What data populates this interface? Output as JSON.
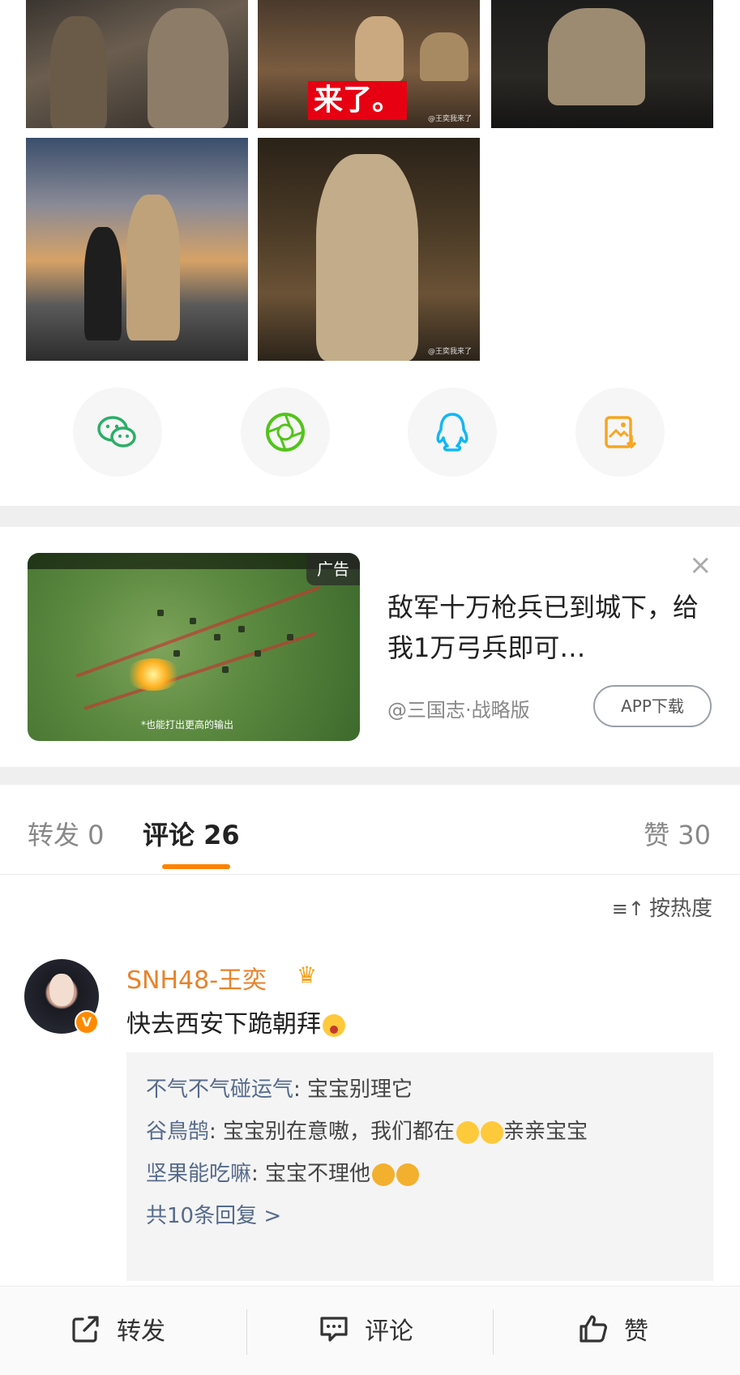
{
  "photos": {
    "grid_overlay_text": "来了。",
    "watermark_2": "@王奕我来了",
    "watermark_5": "@王奕我来了"
  },
  "share": {
    "items": [
      {
        "name": "wechat",
        "color": "#2aae67"
      },
      {
        "name": "moments",
        "color": "#52c41a"
      },
      {
        "name": "qq",
        "color": "#12b7f5"
      },
      {
        "name": "save-image",
        "color": "#f5a623"
      }
    ]
  },
  "ad": {
    "badge": "广告",
    "title": "敌军十万枪兵已到城下，给我1万弓兵即可…",
    "source": "@三国志·战略版",
    "button": "APP下载",
    "caption": "*也能打出更高的输出",
    "close": "×"
  },
  "tabs": {
    "repost": "转发 0",
    "comment": "评论 26",
    "like": "赞 30"
  },
  "sort": {
    "icon": "≡↑",
    "label": "按热度"
  },
  "comment": {
    "author": "SNH48-王奕",
    "badge": "V",
    "text": "快去西安下跪朝拜",
    "replies": [
      {
        "name": "不气不气碰运气",
        "text": "宝宝别理它"
      },
      {
        "name": "谷鳥鹄",
        "text": "宝宝别在意嗷，我们都在"
      },
      {
        "name": "坚果能吃嘛",
        "text": "宝宝不理他"
      }
    ],
    "reply2_tail": "亲亲宝宝",
    "more": "共10条回复 >"
  },
  "toolbar": {
    "repost": "转发",
    "comment": "评论",
    "like": "赞"
  },
  "colors": {
    "accent": "#ff8200",
    "username": "#e8822a",
    "link": "#566b8c"
  }
}
